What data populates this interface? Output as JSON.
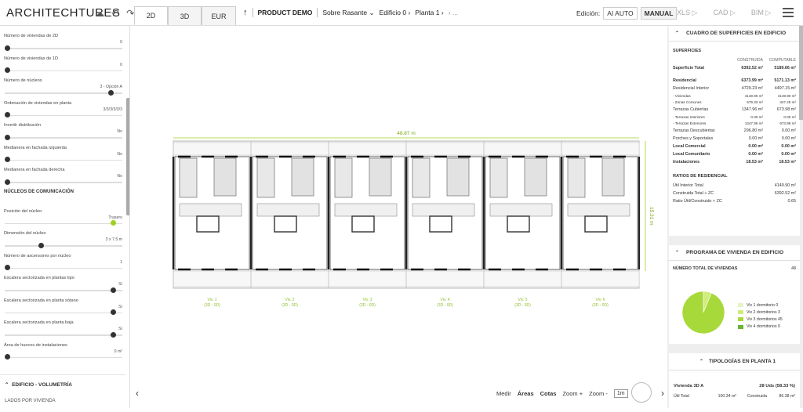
{
  "app": {
    "logo": "ARCHITECHTURES"
  },
  "top_icons": [
    "cloud-upload-icon",
    "undo-icon",
    "redo-icon"
  ],
  "tabs": [
    "2D",
    "3D",
    "EUR"
  ],
  "breadcrumbs": {
    "project": "PRODUCT DEMO",
    "rasante": "Sobre Rasante",
    "edificio": "Edificio 0",
    "planta": "Planta 1",
    "more": "..."
  },
  "edicion": {
    "label": "Edición:",
    "ai": "AI AUTO",
    "manual": "MANUAL"
  },
  "exports": [
    "XLS ▷",
    "CAD ▷",
    "BIM ▷"
  ],
  "left_panel": {
    "rows_top": [
      {
        "label": "Número de viviendas de 2D",
        "value": "0",
        "knob": 0
      },
      {
        "label": "Número de viviendas de 1D",
        "value": "0",
        "knob": 0
      },
      {
        "label": "Número de núcleos",
        "value": "3 - Opción A",
        "knob": 0.96
      },
      {
        "label": "Ordenación de viviendas en planta",
        "value": "3/3/3/3/3/3",
        "knob": 0
      },
      {
        "label": "Invertir distribución",
        "value": "No",
        "knob": 0
      },
      {
        "label": "Medianera en fachada izquierda",
        "value": "No",
        "knob": 0
      },
      {
        "label": "Medianera en fachada derecha",
        "value": "No",
        "knob": 0
      }
    ],
    "section": "NÚCLEOS DE COMUNICACIÓN",
    "rows_bottom": [
      {
        "label": "Posición del núcleo",
        "value": "Trasero",
        "knob": 0.98,
        "green": true
      },
      {
        "label": "Dimensión del núcleo",
        "value": "3 x 7.5 m",
        "knob": 0.31
      },
      {
        "label": "Número de ascensores por núcleo",
        "value": "1",
        "knob": 0
      },
      {
        "label": "Escalera sectorizada en plantas tipo",
        "value": "Sí",
        "knob": 0.98
      },
      {
        "label": "Escalera sectorizada en planta sótano",
        "value": "Sí",
        "knob": 0.98
      },
      {
        "label": "Escalera sectorizada en planta baja",
        "value": "Sí",
        "knob": 0.98
      },
      {
        "label": "Área de huecos de instalaciones",
        "value": "0 m²",
        "knob": 0
      }
    ],
    "footer_section": "EDIFICIO - VOLUMETRÍA",
    "footer_sub": "LADOS POR VIVIENDA"
  },
  "plan": {
    "width_label": "48.87 m",
    "height_label": "15.31 m",
    "units": [
      {
        "name": "Viv. 1",
        "code": "(3D - 0D)"
      },
      {
        "name": "Viv. 2",
        "code": "(3D - 0D)"
      },
      {
        "name": "Viv. 3",
        "code": "(3D - 0D)"
      },
      {
        "name": "Viv. 4",
        "code": "(3D - 0D)"
      },
      {
        "name": "Viv. 5",
        "code": "(3D - 0D)"
      },
      {
        "name": "Viv. 6",
        "code": "(3D - 0D)"
      }
    ]
  },
  "canvas_tools": {
    "medir": "Medir",
    "areas": "Áreas",
    "cotas": "Cotas",
    "zoom_in": "Zoom +",
    "zoom_out": "Zoom -",
    "scale": "1m"
  },
  "superficies": {
    "title": "CUADRO DE SUPERFICIES EN EDIFICIO",
    "section": "SUPERFICIES",
    "col_a": "CONSTRUIDA",
    "col_b": "COMPUTABLE",
    "rows": [
      {
        "label": "Superficie Total",
        "a": "6392.52 m²",
        "b": "5189.66 m²",
        "style": "bold"
      },
      {
        "label": "",
        "a": "",
        "b": "",
        "style": "gap"
      },
      {
        "label": "Residencial",
        "a": "6373.99 m²",
        "b": "5171.13 m²",
        "style": "bold"
      },
      {
        "label": "Residencial Interior",
        "a": "4729.23 m²",
        "b": "4497.15 m²",
        "style": ""
      },
      {
        "label": "- Viviendas",
        "a": "4149.90 m²",
        "b": "4149.90 m²",
        "style": "sm"
      },
      {
        "label": "- Zonas Comunes",
        "a": "579.33 m²",
        "b": "347.25 m²",
        "style": "sm"
      },
      {
        "label": "Terrazas Cubiertas",
        "a": "1347.96 m²",
        "b": "673.98 m²",
        "style": ""
      },
      {
        "label": "- Terrazas Interiores",
        "a": "0.00 m²",
        "b": "0.00 m²",
        "style": "sm"
      },
      {
        "label": "- Terrazas Exteriores",
        "a": "1347.96 m²",
        "b": "673.98 m²",
        "style": "sm"
      },
      {
        "label": "Terrazas Descubiertas",
        "a": "296.80 m²",
        "b": "0.00 m²",
        "style": ""
      },
      {
        "label": "Porches y Soportales",
        "a": "0.00 m²",
        "b": "0.00 m²",
        "style": ""
      },
      {
        "label": "Local Comercial",
        "a": "0.00 m²",
        "b": "0.00 m²",
        "style": "bold"
      },
      {
        "label": "Local Comunitario",
        "a": "0.00 m²",
        "b": "0.00 m²",
        "style": "bold"
      },
      {
        "label": "Instalaciones",
        "a": "18.53 m²",
        "b": "18.53 m²",
        "style": "bold"
      }
    ],
    "ratios_title": "RATIOS DE RESIDENCIAL",
    "ratios": [
      {
        "label": "Útil Interior Total",
        "v": "4149.90 m²"
      },
      {
        "label": "Construida Total + ZC",
        "v": "6392.52 m²"
      },
      {
        "label": "Ratio Útil/Construido + ZC",
        "v": "0.65"
      }
    ]
  },
  "programa": {
    "title": "PROGRAMA DE VIVIENDA EN EDIFICIO",
    "total_label": "NÚMERO TOTAL DE VIVIENDAS",
    "total": "48",
    "legend": [
      {
        "label": "Viv 1 dormitorio 0",
        "value": 0,
        "color": "#e7f3c2"
      },
      {
        "label": "Viv 2 dormitorios 3",
        "value": 3,
        "color": "#d2ec7c"
      },
      {
        "label": "Viv 3 dormitorios 45",
        "value": 45,
        "color": "#a8d93a"
      },
      {
        "label": "Viv 4 dormitorios 0",
        "value": 0,
        "color": "#66b532"
      }
    ]
  },
  "tipologias": {
    "title": "TIPOLOGÍAS EN PLANTA 1",
    "name": "Vivienda 3D A",
    "count": "28 Uds (58.33 %)",
    "util_label": "Útil Total",
    "util": "100.34 m²",
    "const_label": "Construida",
    "const": "86.38 m²"
  }
}
